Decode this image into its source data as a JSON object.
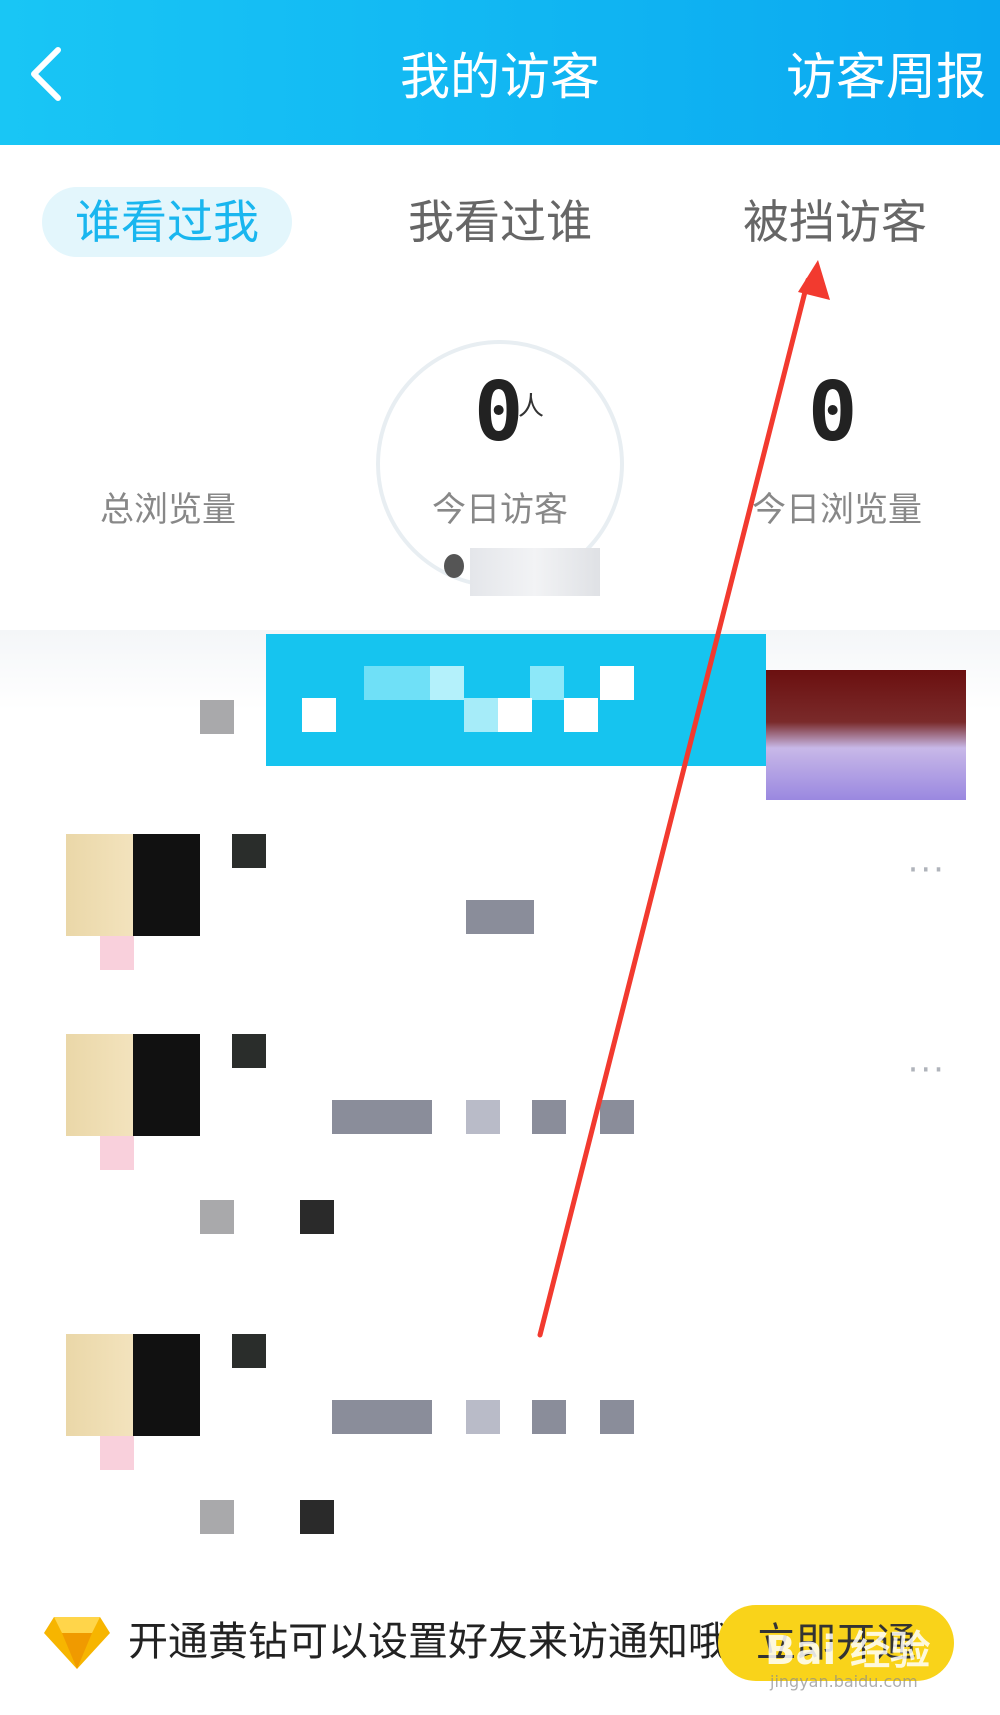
{
  "header": {
    "back_icon": "chevron-left-icon",
    "title": "我的访客",
    "weekly_report": "访客周报"
  },
  "tabs": [
    {
      "label": "谁看过我",
      "active": true
    },
    {
      "label": "我看过谁",
      "active": false
    },
    {
      "label": "被挡访客",
      "active": false
    }
  ],
  "stats": {
    "total_views_label": "总浏览量",
    "today_visitors_value": "0",
    "today_visitors_unit": "人",
    "today_visitors_label": "今日访客",
    "today_views_value": "0",
    "today_views_label": "今日浏览量"
  },
  "visitors": [
    {
      "more": "···"
    },
    {
      "more": "···"
    }
  ],
  "footer": {
    "promo_icon": "yellow-diamond-icon",
    "promo_text": "开通黄钻可以设置好友来访通知哦",
    "open_button": "立即开通"
  },
  "watermark": {
    "text": "Bai 经验",
    "sub": "jingyan.baidu.com"
  },
  "colors": {
    "header_start": "#19c6f5",
    "header_end": "#0aa8f0",
    "active_tab": "#19b6ef",
    "button_yellow": "#f9d31a",
    "annotation_arrow": "#f23a2f"
  }
}
